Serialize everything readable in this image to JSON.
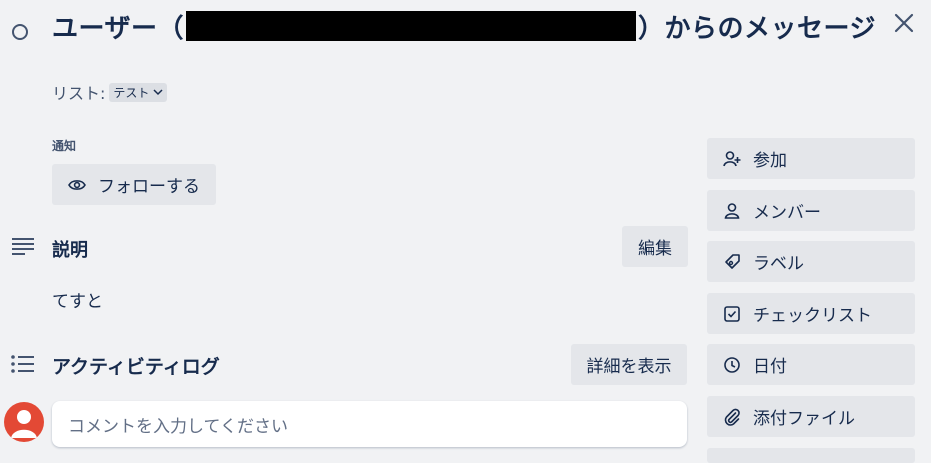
{
  "header": {
    "title_prefix": "ユーザー（",
    "title_suffix": "）からのメッセージ"
  },
  "list": {
    "label": "リスト:",
    "value": "テスト"
  },
  "notifications": {
    "heading": "通知",
    "follow_label": "フォローする"
  },
  "description": {
    "heading": "説明",
    "edit_label": "編集",
    "text": "てすと"
  },
  "activity": {
    "heading": "アクティビティログ",
    "show_details_label": "詳細を表示",
    "comment_placeholder": "コメントを入力してください"
  },
  "sidebar": {
    "items": [
      {
        "label": "参加",
        "icon": "add-member-icon"
      },
      {
        "label": "メンバー",
        "icon": "member-icon"
      },
      {
        "label": "ラベル",
        "icon": "label-icon"
      },
      {
        "label": "チェックリスト",
        "icon": "checklist-icon"
      },
      {
        "label": "日付",
        "icon": "clock-icon"
      },
      {
        "label": "添付ファイル",
        "icon": "attachment-icon"
      }
    ]
  },
  "colors": {
    "background": "#f1f2f4",
    "button": "#e4e6ea",
    "text": "#172b4d",
    "avatar": "#e34935"
  }
}
